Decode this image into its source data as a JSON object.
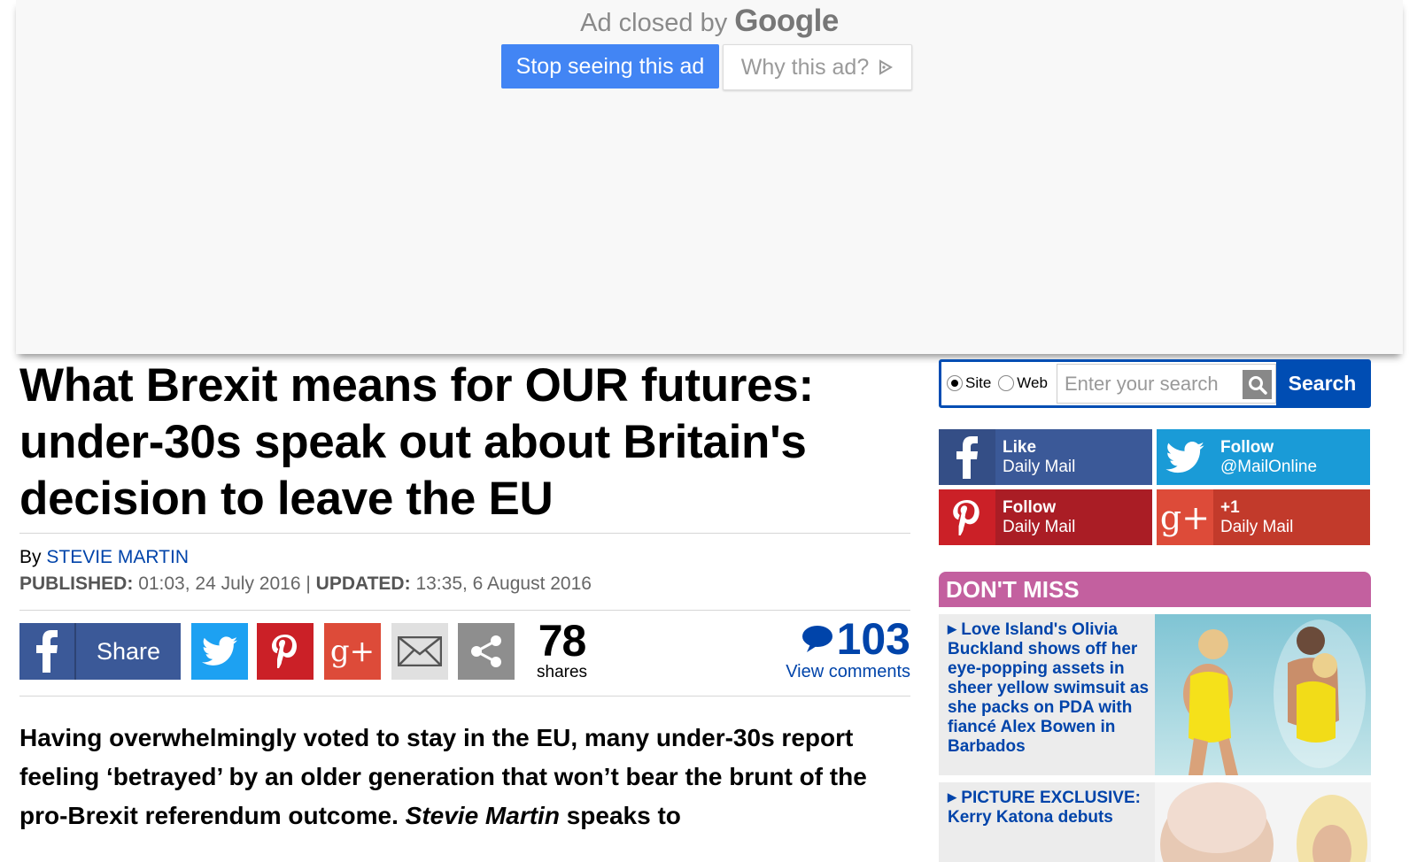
{
  "ad": {
    "closed_text": "Ad closed by",
    "brand": "Google",
    "stop_button": "Stop seeing this ad",
    "why_button": "Why this ad?"
  },
  "article": {
    "headline": "What Brexit means for OUR futures: under-30s speak out about Britain's decision to leave the EU",
    "by_label": "By",
    "author": "STEVIE MARTIN",
    "published_label": "PUBLISHED:",
    "published_value": "01:03, 24 July 2016",
    "separator": "|",
    "updated_label": "UPDATED:",
    "updated_value": "13:35, 6 August 2016",
    "share_label": "Share",
    "shares_count": "78",
    "shares_label": "shares",
    "comments_count": "103",
    "comments_label": "View comments",
    "lede_part1": "Having overwhelmingly voted to stay in the EU, many under-30s report feeling ‘betrayed’ by an older generation that won’t bear the brunt of the pro-Brexit referendum outcome.",
    "lede_italic": "Stevie Martin",
    "lede_part2": "speaks to"
  },
  "search": {
    "radio_site": "Site",
    "radio_web": "Web",
    "selected": "Site",
    "placeholder": "Enter your search",
    "button": "Search"
  },
  "social": {
    "facebook": {
      "line1": "Like",
      "line2": "Daily Mail"
    },
    "twitter": {
      "line1": "Follow",
      "line2": "@MailOnline"
    },
    "pinterest": {
      "line1": "Follow",
      "line2": "Daily Mail"
    },
    "googleplus": {
      "line1": "+1",
      "line2": "Daily Mail"
    }
  },
  "dont_miss": {
    "title": "DON'T MISS",
    "items": [
      {
        "text": "Love Island's Olivia Buckland shows off her eye-popping assets in sheer yellow swimsuit as she packs on PDA with fiancé Alex Bowen in Barbados"
      },
      {
        "text": "PICTURE EXCLUSIVE: Kerry Katona debuts"
      }
    ]
  },
  "colors": {
    "google_blue": "#4285f4",
    "facebook": "#3b5998",
    "twitter": "#1da1f2",
    "pinterest": "#cb2027",
    "googleplus": "#dd4b39",
    "link_blue": "#0044aa",
    "dont_miss_pink": "#c3609f"
  }
}
